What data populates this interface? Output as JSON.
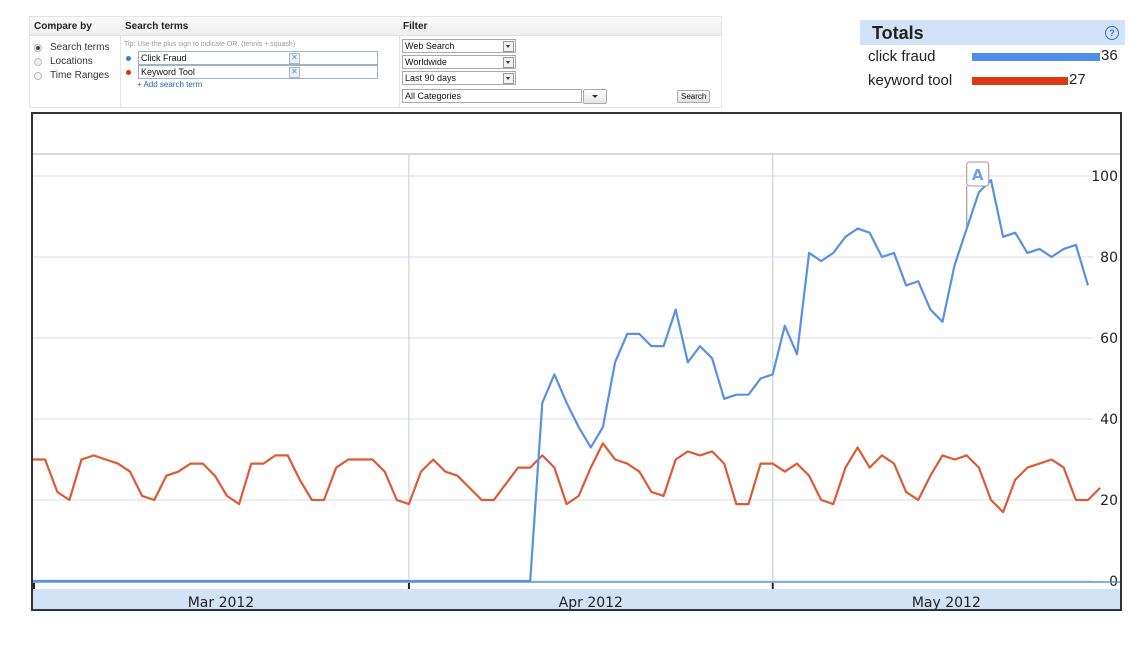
{
  "compare_by": {
    "title": "Compare by",
    "options": [
      {
        "label": "Search terms",
        "selected": true
      },
      {
        "label": "Locations",
        "selected": false
      },
      {
        "label": "Time Ranges",
        "selected": false
      }
    ]
  },
  "search_terms": {
    "title": "Search terms",
    "tip": "Tip: Use the plus sign to indicate OR. (tennis + squash)",
    "terms": [
      {
        "value": "Click Fraud",
        "color": "#4d8fe8"
      },
      {
        "value": "Keyword Tool",
        "color": "#dc3912"
      }
    ],
    "remove_glyph": "✕",
    "add_label": "+ Add search term"
  },
  "filter": {
    "title": "Filter",
    "search_type": "Web Search",
    "location": "Worldwide",
    "time_range": "Last 90 days",
    "category": "All Categories",
    "search_button": "Search"
  },
  "totals": {
    "title": "Totals",
    "help_glyph": "?",
    "items": [
      {
        "label": "click fraud",
        "value": 36,
        "color": "#4d8fe8"
      },
      {
        "label": "keyword tool",
        "value": 27,
        "color": "#dc3912"
      }
    ]
  },
  "chart_data": {
    "type": "line",
    "title": "",
    "xlabel": "",
    "ylabel": "",
    "ylim": [
      0,
      100
    ],
    "yticks": [
      0,
      20,
      40,
      60,
      80,
      100
    ],
    "grid": true,
    "month_labels": [
      "Mar 2012",
      "Apr 2012",
      "May 2012"
    ],
    "month_boundaries_day_index": [
      0,
      31,
      61
    ],
    "annotation": {
      "label": "A",
      "day_index": 77
    },
    "series": [
      {
        "name": "click fraud",
        "color": "#5b8fe6",
        "values": [
          0,
          0,
          0,
          0,
          0,
          0,
          0,
          0,
          0,
          0,
          0,
          0,
          0,
          0,
          0,
          0,
          0,
          0,
          0,
          0,
          0,
          0,
          0,
          0,
          0,
          0,
          0,
          0,
          0,
          0,
          0,
          0,
          0,
          0,
          0,
          0,
          0,
          0,
          0,
          0,
          0,
          0,
          44,
          51,
          44,
          38,
          33,
          38,
          54,
          61,
          61,
          58,
          58,
          67,
          54,
          58,
          55,
          45,
          46,
          46,
          50,
          51,
          63,
          56,
          81,
          79,
          81,
          85,
          87,
          86,
          80,
          81,
          73,
          74,
          67,
          64,
          78,
          87,
          96,
          99,
          85,
          86,
          81,
          82,
          80,
          82,
          83,
          73
        ]
      },
      {
        "name": "keyword tool",
        "color": "#dc5b35",
        "values": [
          30,
          30,
          22,
          20,
          30,
          31,
          30,
          29,
          27,
          21,
          20,
          26,
          27,
          29,
          29,
          26,
          21,
          19,
          29,
          29,
          31,
          31,
          25,
          20,
          20,
          28,
          30,
          30,
          30,
          27,
          20,
          19,
          27,
          30,
          27,
          26,
          23,
          20,
          20,
          24,
          28,
          28,
          31,
          28,
          19,
          21,
          28,
          34,
          30,
          29,
          27,
          22,
          21,
          30,
          32,
          31,
          32,
          29,
          19,
          19,
          29,
          29,
          27,
          29,
          26,
          20,
          19,
          28,
          33,
          28,
          31,
          29,
          22,
          20,
          26,
          31,
          30,
          31,
          28,
          20,
          17,
          25,
          28,
          29,
          30,
          28,
          20,
          20,
          23
        ]
      }
    ]
  }
}
